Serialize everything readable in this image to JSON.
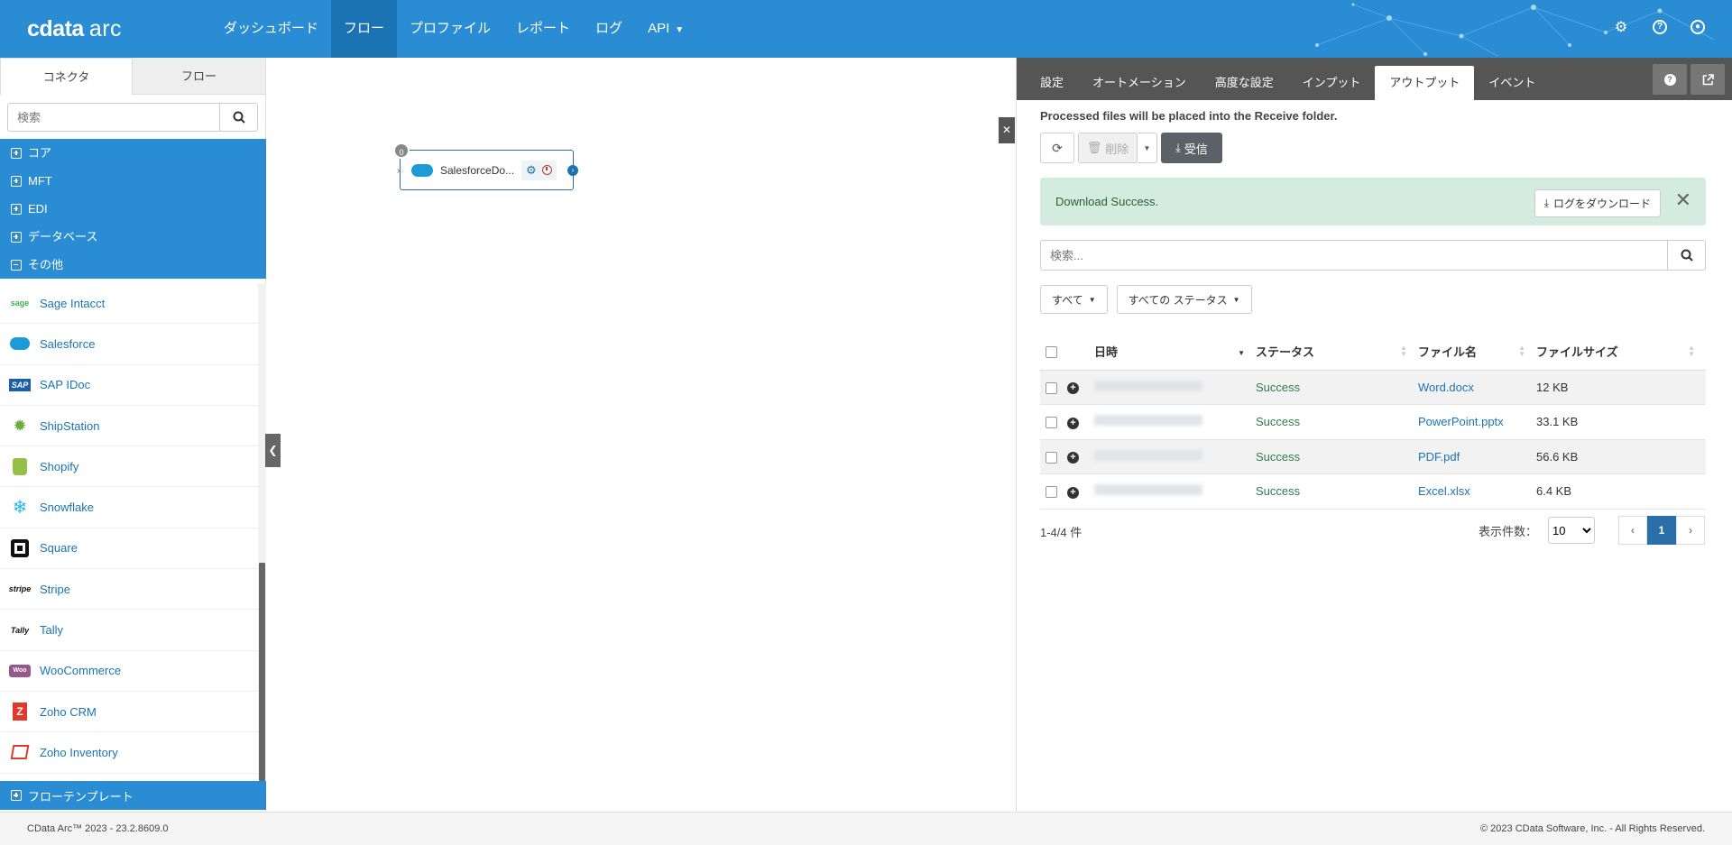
{
  "app": {
    "logo_brand": "cdata",
    "logo_product": "arc"
  },
  "nav": {
    "items": [
      "ダッシュボード",
      "フロー",
      "プロファイル",
      "レポート",
      "ログ",
      "API"
    ],
    "active": "フロー"
  },
  "sidebar": {
    "tabs": [
      "コネクタ",
      "フロー"
    ],
    "search_placeholder": "検索",
    "categories": [
      "コア",
      "MFT",
      "EDI",
      "データベース",
      "その他"
    ],
    "connectors": [
      "Sage Intacct",
      "Salesforce",
      "SAP IDoc",
      "ShipStation",
      "Shopify",
      "Snowflake",
      "Square",
      "Stripe",
      "Tally",
      "WooCommerce",
      "Zoho CRM",
      "Zoho Inventory"
    ],
    "templates": "フローテンプレート"
  },
  "canvas": {
    "node": {
      "badge": "0",
      "label": "SalesforceDo..."
    }
  },
  "panel": {
    "tabs": [
      "設定",
      "オートメーション",
      "高度な設定",
      "インプット",
      "アウトプット",
      "イベント"
    ],
    "active_tab": "アウトプット",
    "info": "Processed files will be placed into the  Receive folder.",
    "actions": {
      "delete": "削除",
      "receive": "受信"
    },
    "alert": {
      "message": "Download Success.",
      "download_log": "ログをダウンロード"
    },
    "search_placeholder": "検索...",
    "filters": {
      "all": "すべて",
      "status": "すべての ステータス"
    },
    "table": {
      "headers": {
        "date": "日時",
        "status": "ステータス",
        "filename": "ファイル名",
        "size": "ファイルサイズ"
      },
      "rows": [
        {
          "status": "Success",
          "filename": "Word.docx",
          "size": "12 KB"
        },
        {
          "status": "Success",
          "filename": "PowerPoint.pptx",
          "size": "33.1 KB"
        },
        {
          "status": "Success",
          "filename": "PDF.pdf",
          "size": "56.6 KB"
        },
        {
          "status": "Success",
          "filename": "Excel.xlsx",
          "size": "6.4 KB"
        }
      ]
    },
    "count": "1-4/4 件",
    "per_page_label": "表示件数：",
    "per_page": "10",
    "page": "1"
  },
  "footer": {
    "left": "CData Arc™ 2023 - 23.2.8609.0",
    "right": "© 2023 CData Software, Inc. - All Rights Reserved."
  },
  "colors": {
    "primary": "#2a8dd4",
    "nav_active": "#1c73b4",
    "success_bg": "#d4ece0",
    "panel_tabs_bg": "#555555"
  }
}
